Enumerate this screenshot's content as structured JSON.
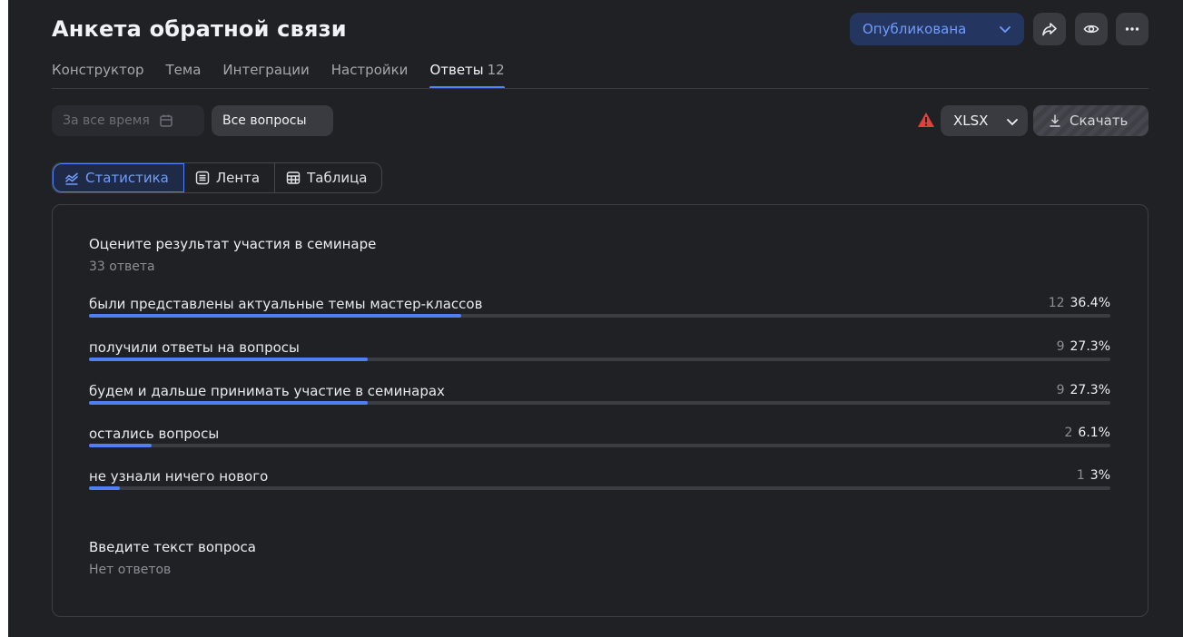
{
  "form": {
    "title": "Анкета обратной связи",
    "status": "Опубликована"
  },
  "icons": {
    "status_chevron": "chevron-down-icon",
    "share": "share-icon",
    "preview": "eye-icon",
    "more": "more-icon",
    "calendar": "calendar-icon",
    "warning": "warning-icon",
    "download": "download-icon",
    "statistics": "chart-icon",
    "feed": "list-icon",
    "table": "table-icon"
  },
  "tabs": [
    {
      "label": "Конструктор"
    },
    {
      "label": "Тема"
    },
    {
      "label": "Интеграции"
    },
    {
      "label": "Настройки"
    },
    {
      "label": "Ответы",
      "count": "12"
    }
  ],
  "filters": {
    "period": "За все время",
    "questions": "Все вопросы"
  },
  "export": {
    "format": "XLSX",
    "download_label": "Скачать"
  },
  "views": [
    {
      "label": "Статистика"
    },
    {
      "label": "Лента"
    },
    {
      "label": "Таблица"
    }
  ],
  "questions": [
    {
      "title": "Оцените результат участия в семинаре",
      "answers_count": "33 ответа",
      "options": [
        {
          "label": "были представлены актуальные темы мастер-классов",
          "count": "12",
          "percent": "36.4%",
          "value": 0.364
        },
        {
          "label": "получили ответы на вопросы",
          "count": "9",
          "percent": "27.3%",
          "value": 0.273
        },
        {
          "label": "будем и дальше принимать участие в семинарах",
          "count": "9",
          "percent": "27.3%",
          "value": 0.273
        },
        {
          "label": "остались вопросы",
          "count": "2",
          "percent": "6.1%",
          "value": 0.061
        },
        {
          "label": "не узнали ничего нового",
          "count": "1",
          "percent": "3%",
          "value": 0.03
        }
      ]
    },
    {
      "title": "Введите текст вопроса",
      "answers_count": "Нет ответов"
    }
  ],
  "colors": {
    "accent": "#5282ff",
    "bar": "#4f7ff2",
    "background": "#202125",
    "warning": "#e0423b"
  }
}
